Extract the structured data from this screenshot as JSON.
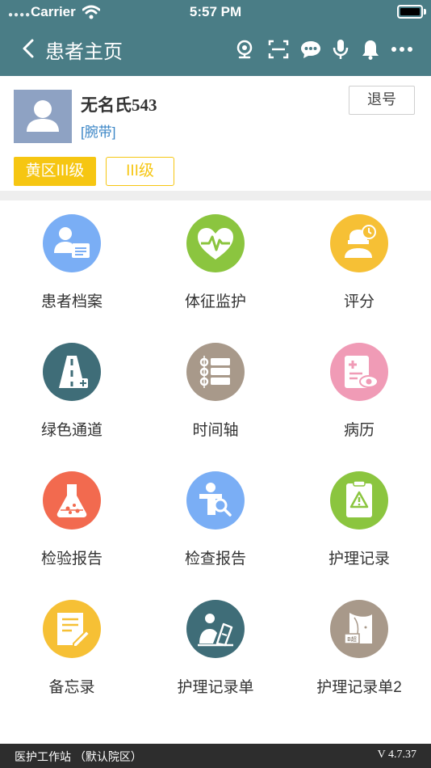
{
  "status_bar": {
    "carrier": "Carrier",
    "time": "5:57 PM"
  },
  "nav": {
    "title": "患者主页"
  },
  "patient": {
    "name": "无名氏543",
    "band": "[腕带]",
    "logout_label": "退号",
    "zone_tag": "黄区III级",
    "level_tag": "III级"
  },
  "menu": [
    {
      "label": "患者档案",
      "icon": "patient-file-icon",
      "color": "#7aaef5"
    },
    {
      "label": "体征监护",
      "icon": "heart-monitor-icon",
      "color": "#8bc53f"
    },
    {
      "label": "评分",
      "icon": "score-icon",
      "color": "#f6c035"
    },
    {
      "label": "绿色通道",
      "icon": "green-channel-icon",
      "color": "#3f6d78"
    },
    {
      "label": "时间轴",
      "icon": "timeline-icon",
      "color": "#a8998a"
    },
    {
      "label": "病历",
      "icon": "medical-record-icon",
      "color": "#f09bb6"
    },
    {
      "label": "检验报告",
      "icon": "lab-flask-icon",
      "color": "#f26a4f"
    },
    {
      "label": "检查报告",
      "icon": "exam-report-icon",
      "color": "#7aaef5"
    },
    {
      "label": "护理记录",
      "icon": "nursing-record-icon",
      "color": "#8bc53f"
    },
    {
      "label": "备忘录",
      "icon": "memo-icon",
      "color": "#f6c035"
    },
    {
      "label": "护理记录单",
      "icon": "nursing-sheet-icon",
      "color": "#3f6d78"
    },
    {
      "label": "护理记录单2",
      "icon": "ultrasound-icon",
      "color": "#a8998a"
    }
  ],
  "footer": {
    "app": "医护工作站 （默认院区）",
    "version": "V 4.7.37"
  },
  "colors": {
    "nav_bg": "#4a7d86",
    "tag_yellow": "#f6c612",
    "link_blue": "#3b86c6"
  }
}
